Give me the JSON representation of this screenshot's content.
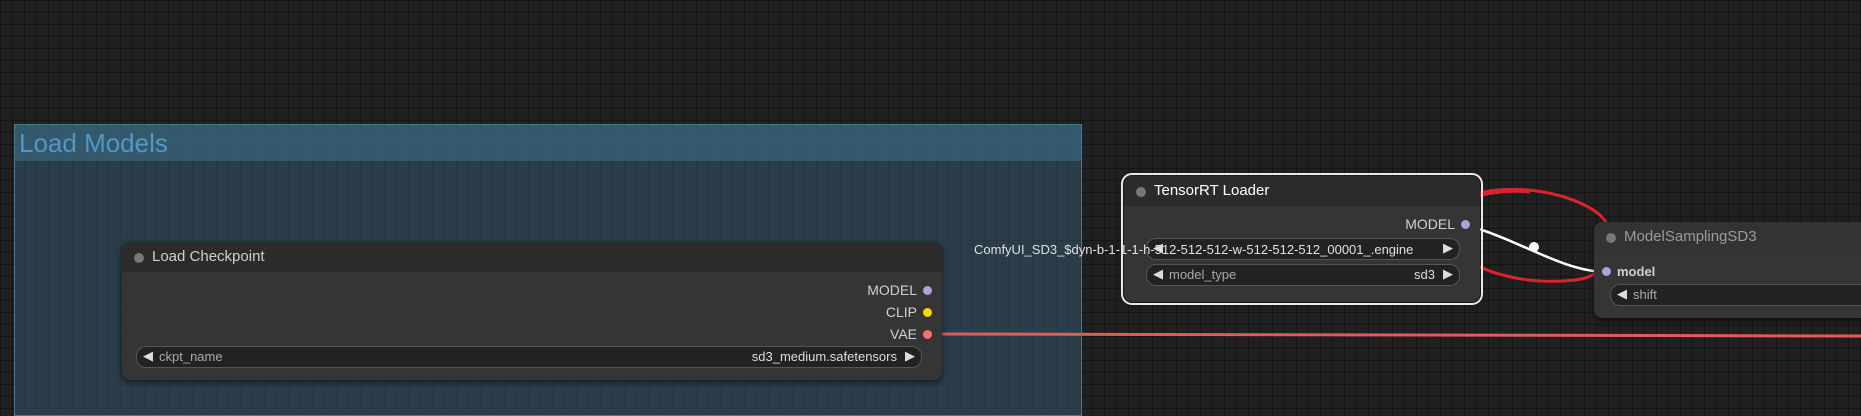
{
  "group": {
    "title": "Load Models"
  },
  "load_checkpoint": {
    "title": "Load Checkpoint",
    "outputs": [
      "MODEL",
      "CLIP",
      "VAE"
    ],
    "widget": {
      "label": "ckpt_name",
      "value": "sd3_medium.safetensors"
    }
  },
  "tensorrt_loader": {
    "title": "TensorRT Loader",
    "output": "MODEL",
    "unet_name": "ComfyUI_SD3_$dyn-b-1-1-1-h-512-512-512-w-512-512-512_00001_.engine",
    "model_type": {
      "label": "model_type",
      "value": "sd3"
    }
  },
  "model_sampling": {
    "title": "ModelSamplingSD3",
    "input": "model",
    "widget": {
      "label": "shift"
    }
  },
  "colors": {
    "model_slot": "#b39ddb",
    "clip_slot": "#ffd500",
    "vae_slot": "#ff6e6e",
    "vae_link": "#e35a5a",
    "annotation": "#d9242e"
  },
  "icons": [
    "node-status-dot",
    "left-arrow",
    "right-arrow"
  ]
}
